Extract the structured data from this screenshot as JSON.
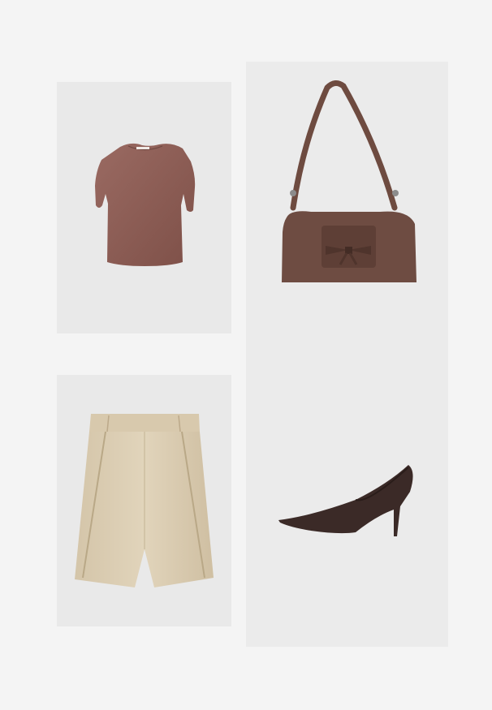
{
  "items": [
    {
      "id": "top",
      "kind": "short-sleeve top",
      "color": "#8c5a52"
    },
    {
      "id": "bag",
      "kind": "bow shoulder bag",
      "color": "#6b4a3f"
    },
    {
      "id": "shorts",
      "kind": "pleated shorts",
      "color": "#d9cbb0"
    },
    {
      "id": "pumps",
      "kind": "croc-effect pumps",
      "color": "#3a2a27"
    }
  ],
  "colors": {
    "page": "#f4f4f4",
    "panel": "#e9e9e9"
  }
}
